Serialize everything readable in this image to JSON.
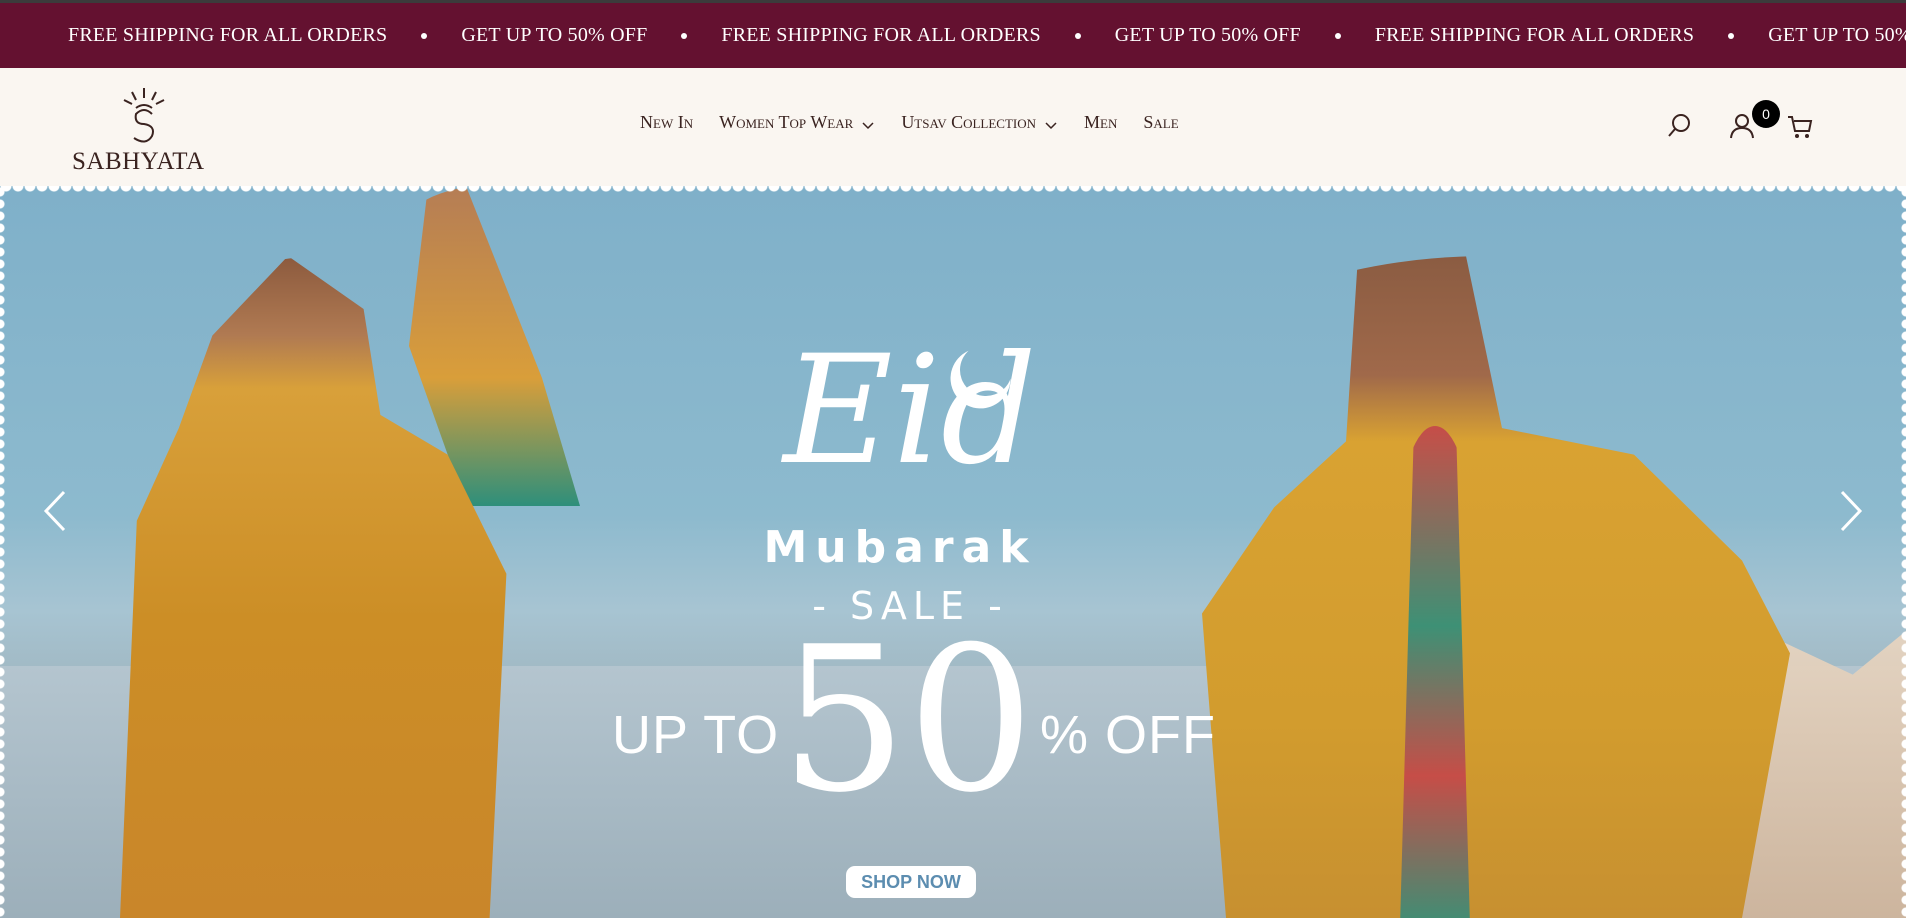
{
  "announcement": {
    "messages": [
      "FREE SHIPPING FOR ALL ORDERS",
      "GET UP TO 50% OFF",
      "FREE SHIPPING FOR ALL ORDERS",
      "GET UP TO 50% OFF",
      "FREE SHIPPING FOR ALL ORDERS",
      "GET UP TO 50%"
    ]
  },
  "brand": {
    "name": "SABHYATA"
  },
  "nav": {
    "items": [
      {
        "label": "New In",
        "has_dropdown": false
      },
      {
        "label": "Women Top Wear",
        "has_dropdown": true
      },
      {
        "label": "Utsav Collection",
        "has_dropdown": true
      },
      {
        "label": "Men",
        "has_dropdown": false
      },
      {
        "label": "Sale",
        "has_dropdown": false
      }
    ]
  },
  "header_icons": [
    "search-icon",
    "account-icon",
    "cart-icon"
  ],
  "cart": {
    "count": "0"
  },
  "hero": {
    "eid": "Eid",
    "mubarak": "Mubarak",
    "sale": "- SALE -",
    "up_to": "UP TO",
    "amount": "50",
    "off": "% OFF",
    "cta": "SHOP NOW"
  },
  "colors": {
    "announcement_bg": "#641130",
    "header_bg": "#faf6f1",
    "text_dark": "#3a2320",
    "cta_text": "#5c8db0"
  }
}
